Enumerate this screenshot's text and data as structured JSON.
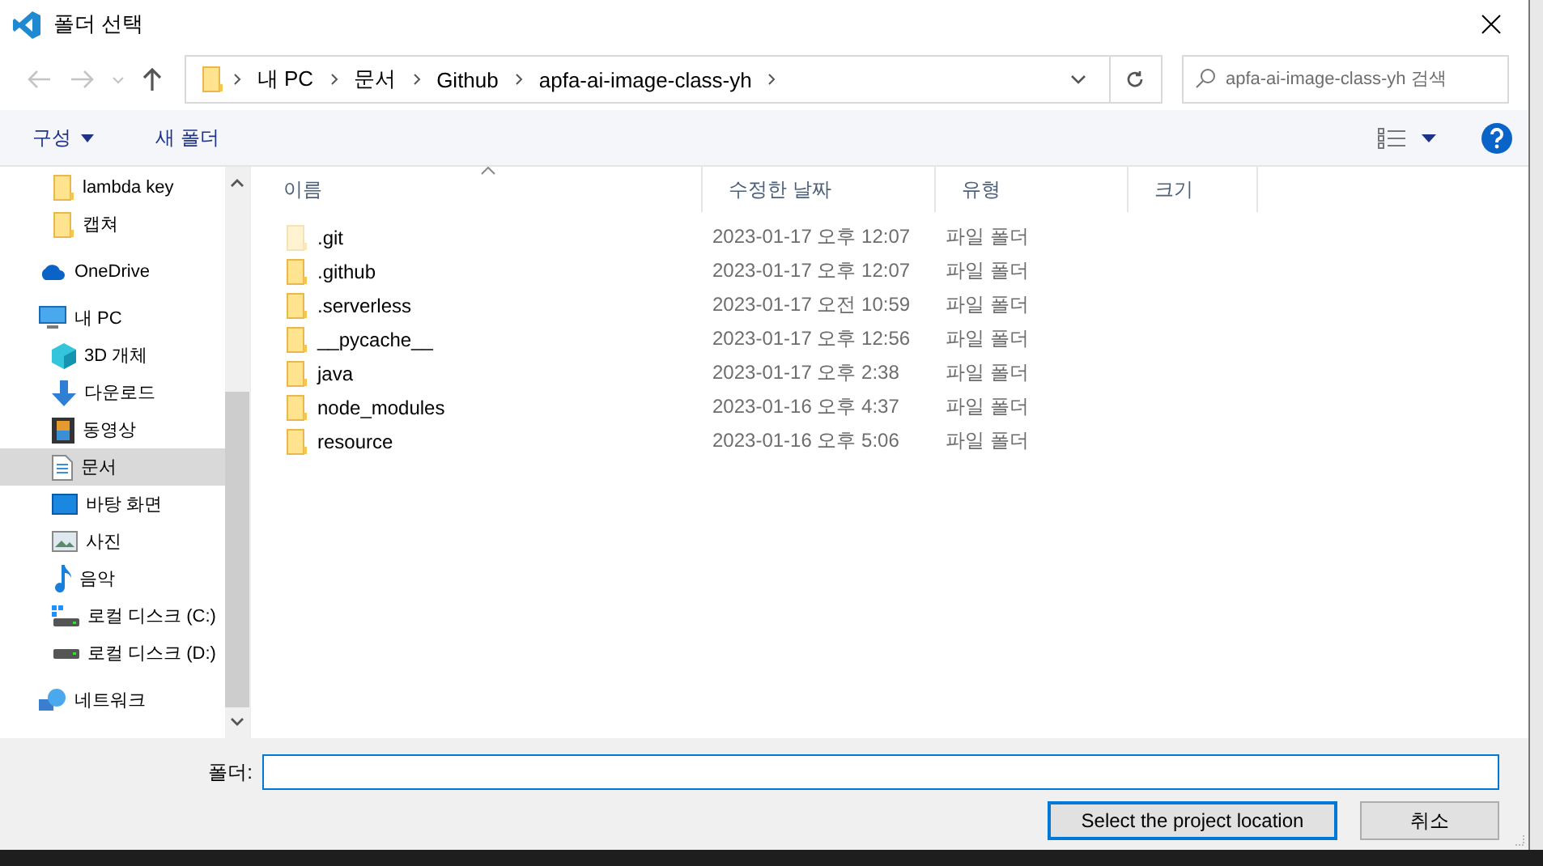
{
  "window": {
    "title": "폴더 선택"
  },
  "navigation": {
    "back_disabled": true,
    "forward_disabled": true
  },
  "breadcrumbs": [
    "내 PC",
    "문서",
    "Github",
    "apfa-ai-image-class-yh"
  ],
  "search": {
    "placeholder": "apfa-ai-image-class-yh 검색"
  },
  "commands": [
    {
      "label": "구성",
      "dropdown": true
    },
    {
      "label": "새 폴더",
      "dropdown": false
    }
  ],
  "quick_access_items": [
    {
      "label": "lambda key",
      "kind": "folder",
      "selected": false
    },
    {
      "label": "캡쳐",
      "kind": "folder",
      "selected": false
    }
  ],
  "sidebar": {
    "items": [
      {
        "label": "OneDrive",
        "kind": "cloud",
        "selected": false
      },
      {
        "label": "내 PC",
        "kind": "pc",
        "selected": false,
        "children": [
          {
            "label": "3D 개체",
            "kind": "cube",
            "selected": false
          },
          {
            "label": "다운로드",
            "kind": "download",
            "selected": false
          },
          {
            "label": "동영상",
            "kind": "film",
            "selected": false
          },
          {
            "label": "문서",
            "kind": "document",
            "selected": true
          },
          {
            "label": "바탕 화면",
            "kind": "desktop",
            "selected": false
          },
          {
            "label": "사진",
            "kind": "picture",
            "selected": false
          },
          {
            "label": "음악",
            "kind": "music",
            "selected": false
          },
          {
            "label": "로컬 디스크 (C:)",
            "kind": "system-drive",
            "selected": false
          },
          {
            "label": "로컬 디스크 (D:)",
            "kind": "drive",
            "selected": false
          }
        ]
      },
      {
        "label": "네트워크",
        "kind": "network",
        "selected": false
      }
    ]
  },
  "table": {
    "columns": [
      {
        "label": "이름",
        "sorted": true
      },
      {
        "label": "수정한 날짜",
        "sorted": false
      },
      {
        "label": "유형",
        "sorted": false
      },
      {
        "label": "크기",
        "sorted": false
      }
    ],
    "rows": [
      {
        "name": ".git",
        "modified": "2023-01-17 오후 12:07",
        "type": "파일 폴더",
        "hidden": true
      },
      {
        "name": ".github",
        "modified": "2023-01-17 오후 12:07",
        "type": "파일 폴더",
        "hidden": false
      },
      {
        "name": ".serverless",
        "modified": "2023-01-17 오전 10:59",
        "type": "파일 폴더",
        "hidden": false
      },
      {
        "name": "__pycache__",
        "modified": "2023-01-17 오후 12:56",
        "type": "파일 폴더",
        "hidden": false
      },
      {
        "name": "java",
        "modified": "2023-01-17 오후 2:38",
        "type": "파일 폴더",
        "hidden": false
      },
      {
        "name": "node_modules",
        "modified": "2023-01-16 오후 4:37",
        "type": "파일 폴더",
        "hidden": false
      },
      {
        "name": "resource",
        "modified": "2023-01-16 오후 5:06",
        "type": "파일 폴더",
        "hidden": false
      }
    ]
  },
  "folder_field": {
    "label": "폴더:"
  },
  "buttons": [
    {
      "label": "Select the project location",
      "primary": true
    },
    {
      "label": "취소",
      "primary": false
    }
  ]
}
